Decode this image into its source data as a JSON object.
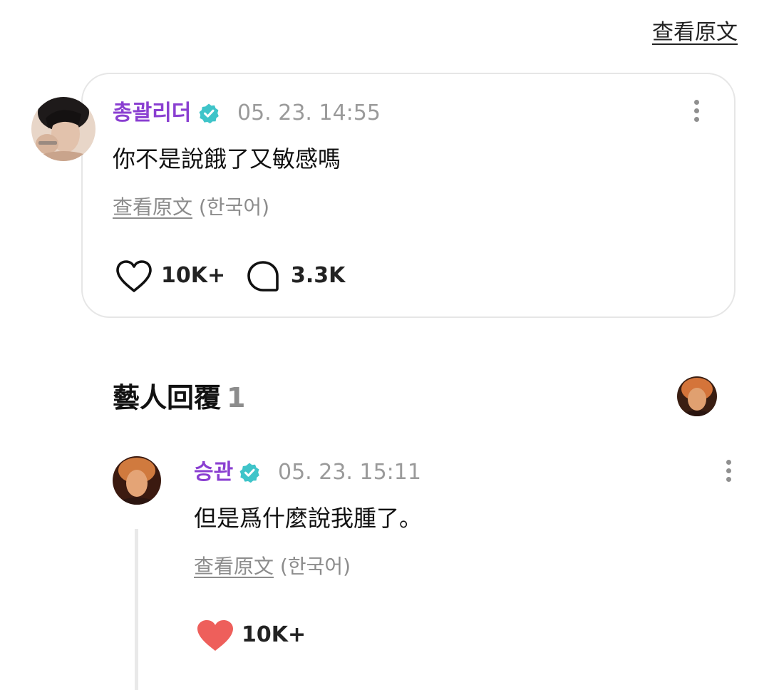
{
  "header": {
    "view_original": "查看原文"
  },
  "comment": {
    "username": "총괄리더",
    "timestamp": "05. 23. 14:55",
    "text": "你不是說餓了又敏感嗎",
    "translate_link": "查看原文",
    "translate_language": "(한국어)",
    "likes": "10K+",
    "replies": "3.3K"
  },
  "artist_replies": {
    "title": "藝人回覆",
    "count": "1"
  },
  "reply": {
    "username": "승관",
    "timestamp": "05. 23. 15:11",
    "text": "但是爲什麼說我腫了。",
    "translate_link": "查看原文",
    "translate_language": "(한국어)",
    "likes": "10K+"
  },
  "colors": {
    "username": "#8a3fd1",
    "verified_badge": "#3fc4c9",
    "liked_heart": "#ee5f5b",
    "muted_text": "#9a9a9a"
  },
  "icons": {
    "verified": "verified-badge-icon",
    "like": "heart-outline-icon",
    "liked": "heart-filled-icon",
    "comment": "comment-bubble-icon",
    "more": "more-vertical-icon"
  }
}
